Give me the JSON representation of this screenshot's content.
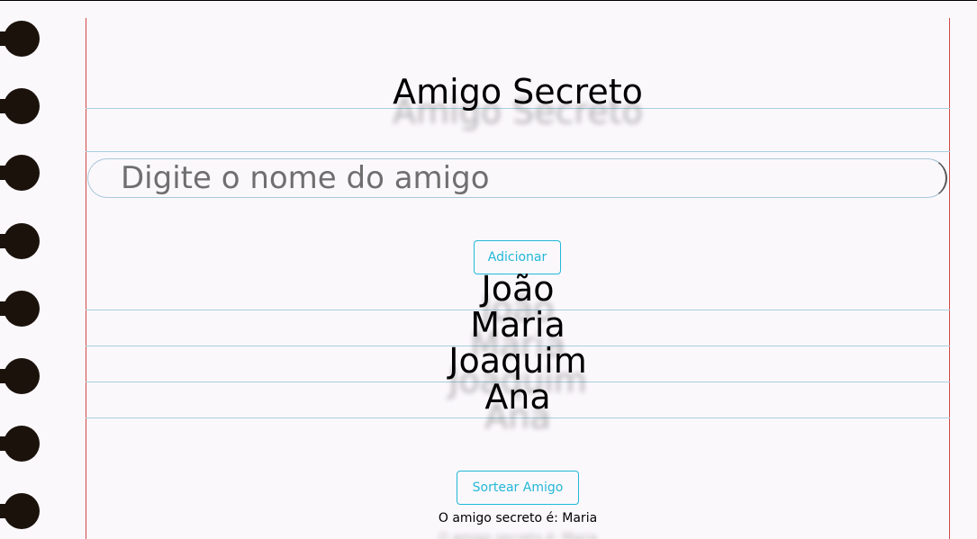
{
  "app": {
    "title": "Amigo Secreto"
  },
  "input": {
    "placeholder": "Digite o nome do amigo",
    "value": ""
  },
  "buttons": {
    "add_label": "Adicionar",
    "draw_label": "Sortear Amigo"
  },
  "friends": [
    "João",
    "Maria",
    "Joaquim",
    "Ana"
  ],
  "result": {
    "text": "O amigo secreto é: Maria"
  },
  "colors": {
    "page_background": "#fbf8fc",
    "margin_line": "#d04848",
    "rule_line": "#a8cfe0",
    "button_accent": "#22b8d6",
    "binder_hole": "#1b120c"
  },
  "icons": [
    "binder-hole-icon"
  ]
}
